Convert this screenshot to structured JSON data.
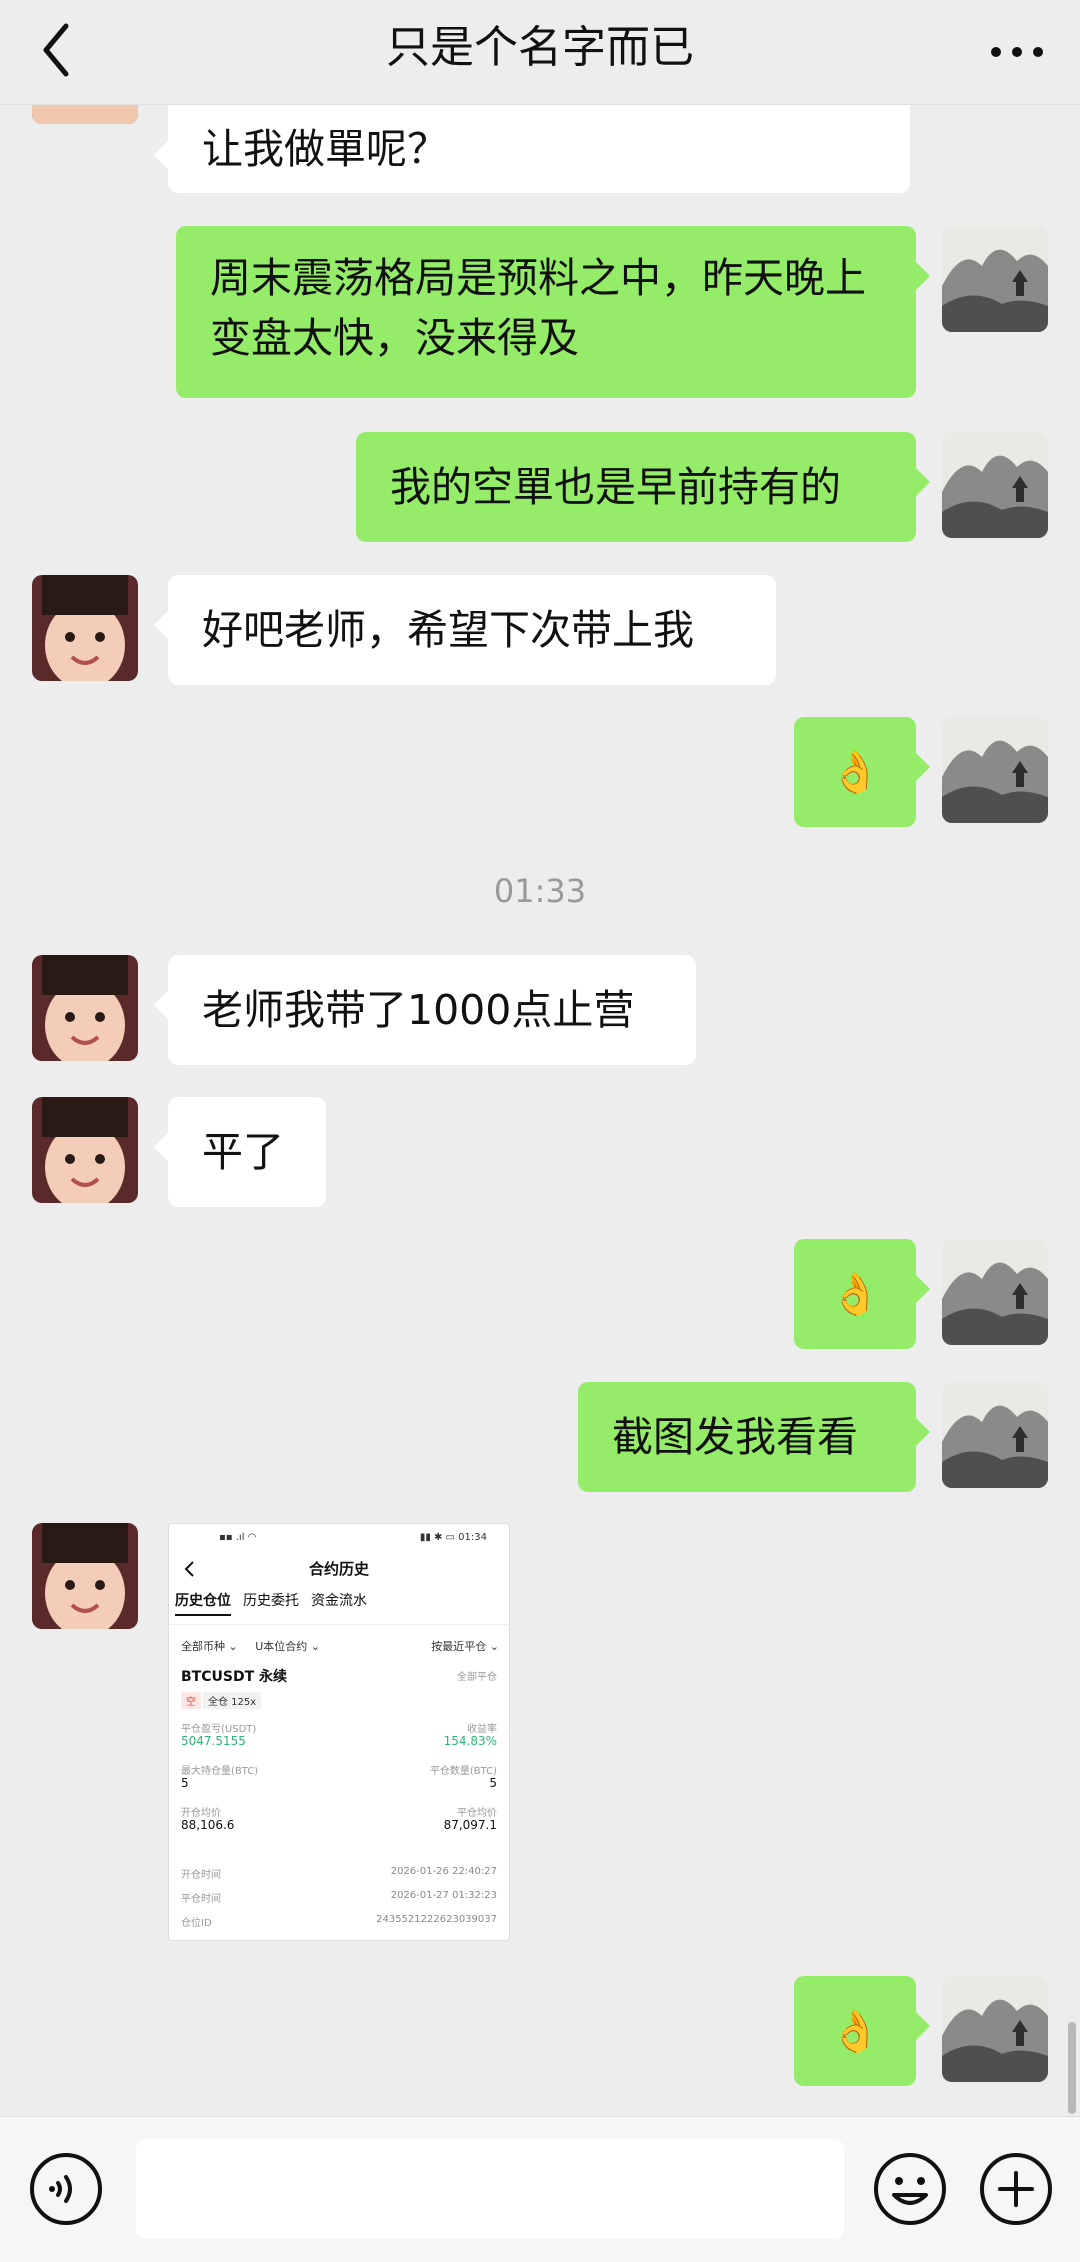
{
  "header": {
    "title": "只是个名字而已",
    "back_icon": "chevron-left-icon",
    "more_icon": "more-dots-icon"
  },
  "messages": [
    {
      "side": "in",
      "text": "让我做單呢？"
    },
    {
      "side": "out",
      "text": "周末震荡格局是预料之中，昨天晚上变盘太快，没来得及"
    },
    {
      "side": "out",
      "text": "我的空單也是早前持有的"
    },
    {
      "side": "in",
      "text": "好吧老师，希望下次带上我"
    },
    {
      "side": "out",
      "text": "👌"
    },
    {
      "side": "in",
      "text": "老师我带了1000点止营"
    },
    {
      "side": "in",
      "text": "平了"
    },
    {
      "side": "out",
      "text": "👌"
    },
    {
      "side": "out",
      "text": "截图发我看看"
    },
    {
      "side": "out",
      "text": "👌"
    }
  ],
  "timestamp": "01:33",
  "screenshot": {
    "status_left": "▪▪ .ıl ◠",
    "status_right": "▮▮ ✱ ▭ 01:34",
    "title": "合约历史",
    "tabs": [
      "历史仓位",
      "历史委托",
      "资金流水"
    ],
    "filter_coin": "全部币种 ⌄",
    "filter_contract": "U本位合约 ⌄",
    "sort": "按最近平仓 ⌄",
    "pair": "BTCUSDT 永续",
    "all_close": "全部平仓",
    "tag_side": "空",
    "tag_leverage": "全仓 125x",
    "pnl_label": "平仓盈亏(USDT)",
    "pnl_value": "5047.5155",
    "roi_label": "收益率",
    "roi_value": "154.83%",
    "max_pos_label": "最大持仓量(BTC)",
    "max_pos_value": "5",
    "closed_qty_label": "平仓数量(BTC)",
    "closed_qty_value": "5",
    "open_avg_label": "开仓均价",
    "open_avg_value": "88,106.6",
    "close_avg_label": "平仓均价",
    "close_avg_value": "87,097.1",
    "open_time_label": "开仓时间",
    "open_time_value": "2026-01-26 22:40:27",
    "close_time_label": "平仓时间",
    "close_time_value": "2026-01-27 01:32:23",
    "position_id_label": "仓位ID",
    "position_id_value": "2435521222623039037"
  },
  "input_bar": {
    "voice_icon": "voice-icon",
    "emoji_icon": "emoji-icon",
    "plus_icon": "plus-icon",
    "text": ""
  },
  "colors": {
    "background": "#ededed",
    "outgoing_bubble": "#95ec69",
    "incoming_bubble": "#ffffff",
    "timestamp": "#999999",
    "profit_green": "#2bb673"
  }
}
